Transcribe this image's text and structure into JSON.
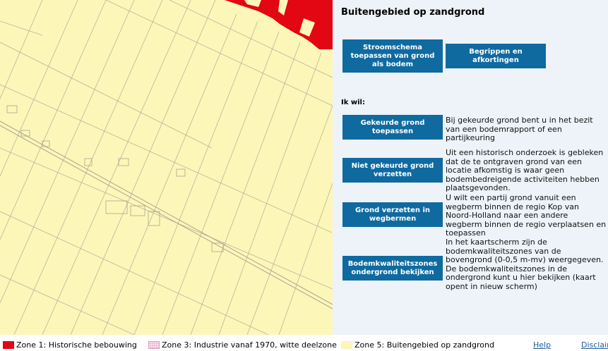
{
  "panel": {
    "title": "Buitengebied op zandgrond",
    "top_buttons": [
      {
        "label": "Stroomschema toepassen van grond als bodem"
      },
      {
        "label": "Begrippen en afkortingen"
      }
    ],
    "ik_wil": "Ik wil:",
    "actions": [
      {
        "label": "Gekeurde grond toepassen",
        "description": "Bij gekeurde grond bent u in het bezit van een bodemrapport of een partijkeuring"
      },
      {
        "label": "Niet gekeurde grond verzetten",
        "description": "Uit een historisch onderzoek is gebleken dat de te ontgraven grond van een locatie afkomstig is waar geen bodembedreigende activiteiten hebben plaatsgevonden."
      },
      {
        "label": "Grond verzetten in wegbermen",
        "description": "U wilt een partij grond vanuit een wegberm binnen de regio Kop van Noord-Holland naar een andere wegberm binnen de regio verplaatsen en toepassen"
      },
      {
        "label": "Bodemkwaliteitszones ondergrond bekijken",
        "description": "In het kaartscherm zijn de bodemkwaliteitszones van de bovengrond (0-0,5 m-mv) weergegeven. De bodemkwaliteitszones in de ondergrond kunt u hier bekijken (kaart opent in nieuw scherm)"
      }
    ]
  },
  "legend": {
    "items": [
      {
        "label": "Zone 1: Historische bebouwing",
        "color": "#e30613"
      },
      {
        "label": "Zone 3: Industrie vanaf 1970, witte deelzone",
        "color": "#f3b6d6"
      },
      {
        "label": "Zone 5: Buitengebied op zandgrond",
        "color": "#fdf6b9"
      }
    ],
    "help": "Help",
    "disclaimer": "Disclaimer"
  },
  "colors": {
    "button": "#0f6aa0",
    "map_base": "#fdf6b9",
    "zone1": "#e30613"
  }
}
